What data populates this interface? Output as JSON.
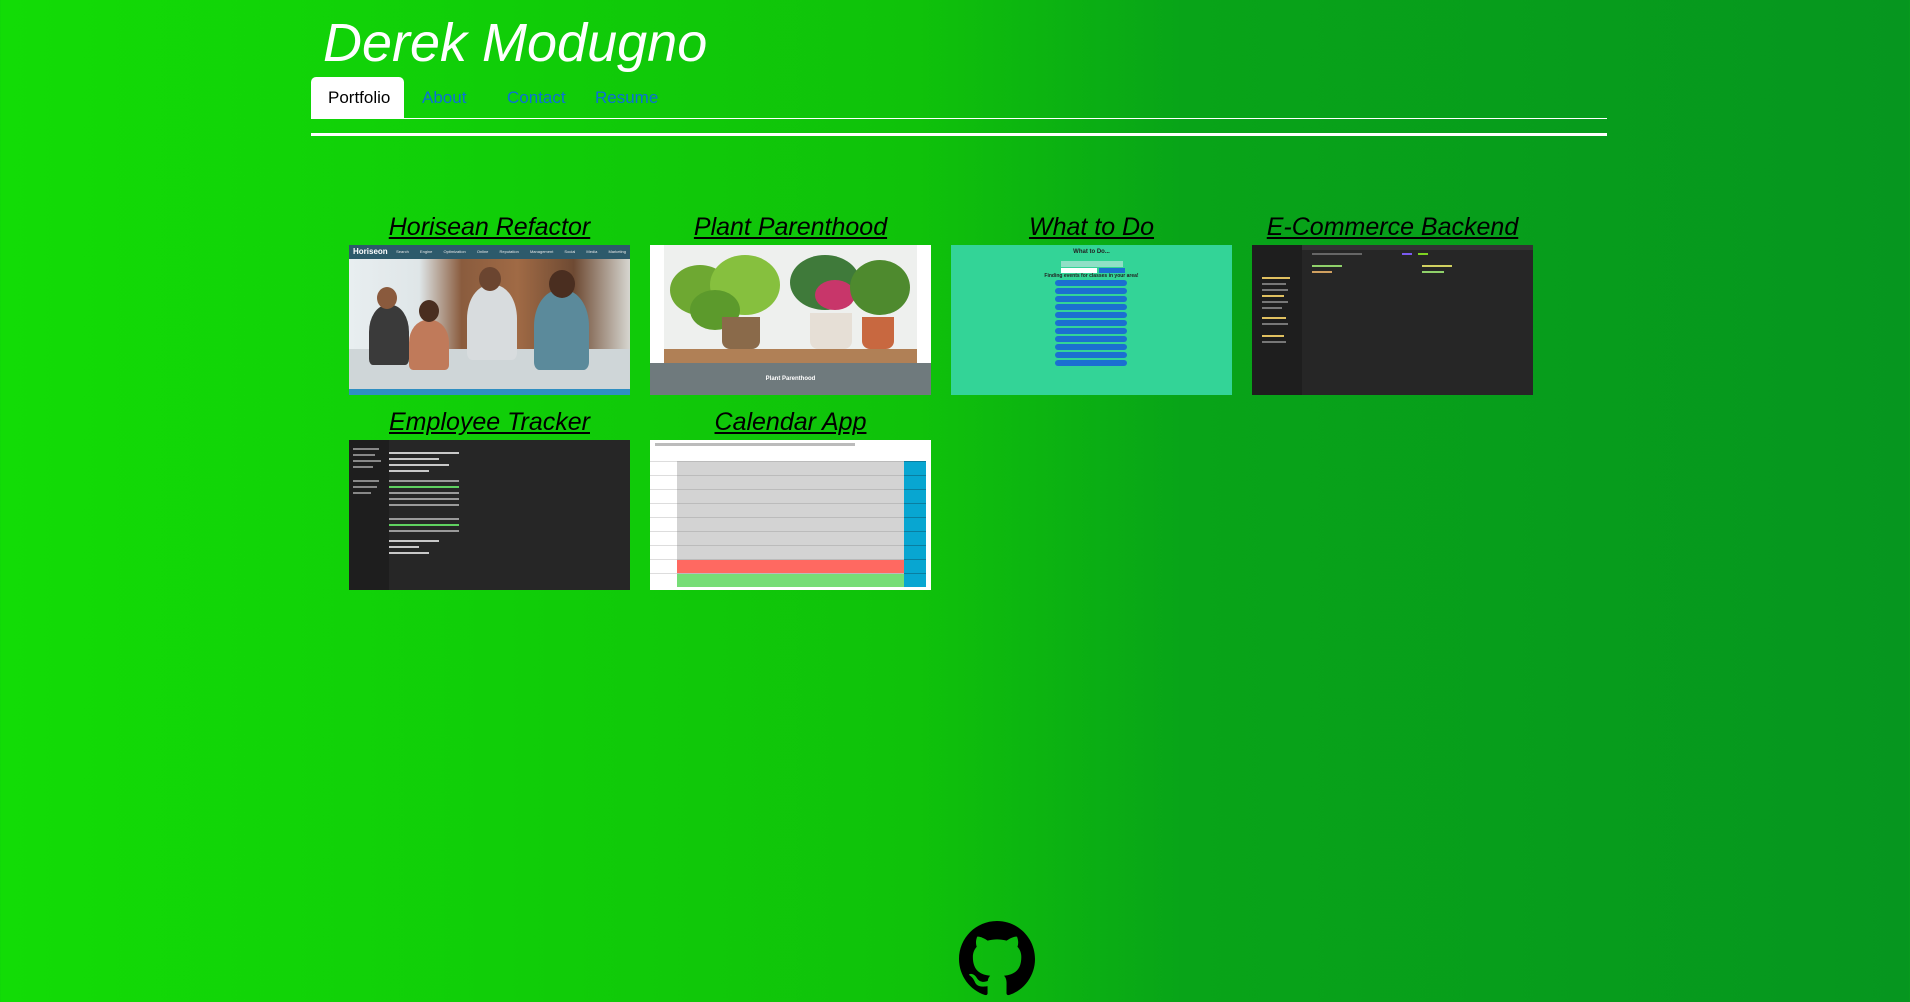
{
  "site": {
    "title": "Derek Modugno"
  },
  "nav": {
    "tabs": [
      {
        "label": "Portfolio",
        "active": true
      },
      {
        "label": "About",
        "active": false
      },
      {
        "label": "Contact",
        "active": false
      },
      {
        "label": "Resume",
        "active": false
      }
    ]
  },
  "projects": [
    {
      "title": "Horisean Refactor"
    },
    {
      "title": "Plant Parenthood"
    },
    {
      "title": "What to Do"
    },
    {
      "title": "E-Commerce Backend"
    },
    {
      "title": "Employee Tracker"
    },
    {
      "title": "Calendar App"
    }
  ],
  "screens": {
    "horiseon": {
      "brand": "Horiseon",
      "nav": "Search Engine Optimization   Online Reputation Management   Social Media Marketing"
    },
    "plant": {
      "footer": "Plant Parenthood"
    },
    "whattodo": {
      "heading": "What to Do...",
      "subheading": "Finding events for classes in your area!"
    }
  },
  "footer": {
    "icon": "github-icon"
  },
  "colors": {
    "bg_left": "#12dc06",
    "bg_right": "#06961f",
    "link": "#0b6fd8",
    "white": "#ffffff"
  }
}
